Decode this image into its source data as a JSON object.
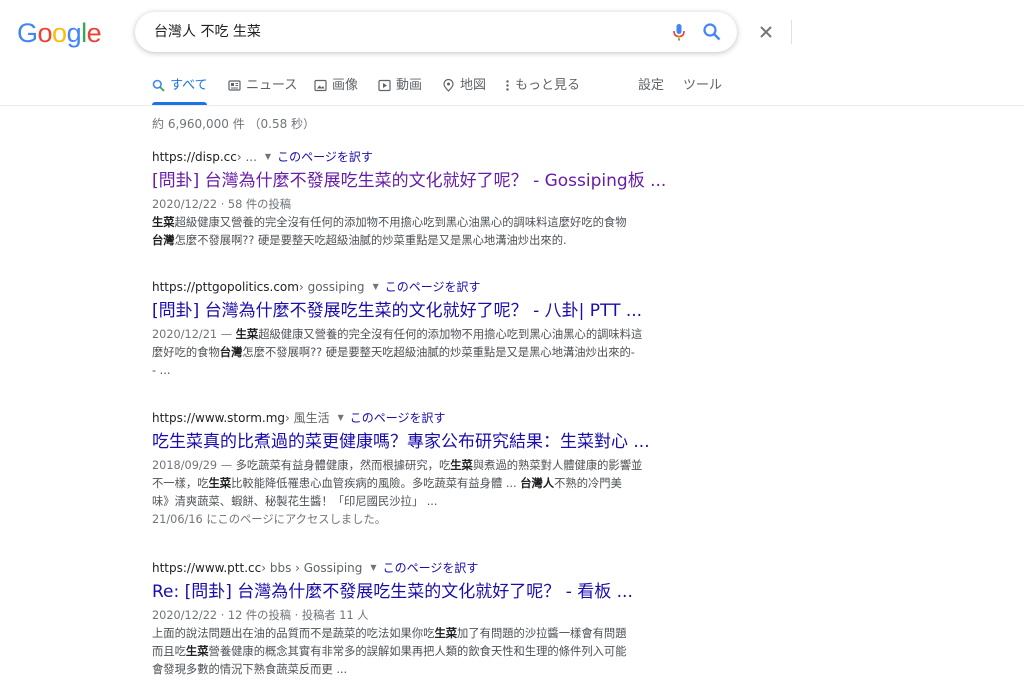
{
  "logo": {
    "letters": [
      "G",
      "o",
      "o",
      "g",
      "l",
      "e"
    ],
    "colors": [
      "#4285f4",
      "#ea4335",
      "#fbbc05",
      "#4285f4",
      "#34a853",
      "#ea4335"
    ]
  },
  "search": {
    "query": "台灣人 不吃 生菜"
  },
  "tabs": [
    {
      "label": "すべて",
      "icon": "search-icon"
    },
    {
      "label": "ニュース",
      "icon": "news-icon"
    },
    {
      "label": "画像",
      "icon": "image-icon"
    },
    {
      "label": "動画",
      "icon": "video-icon"
    },
    {
      "label": "地図",
      "icon": "map-pin-icon"
    },
    {
      "label": "もっと見る",
      "icon": "more-vert-icon"
    },
    {
      "label": "設定"
    },
    {
      "label": "ツール"
    }
  ],
  "stats": "約 6,960,000 件 （0.58 秒）",
  "results": [
    {
      "url": "https://disp.cc",
      "path": " › ...",
      "translate": "このページを訳す",
      "title": "[問卦] 台灣為什麼不發展吃生菜的文化就好了呢？ - Gossiping板 ...",
      "meta": "2020/12/22 · 58 件の投稿",
      "lines": [
        "<b>生菜</b>超級健康又營養的完全沒有任何的添加物不用擔心吃到黑心油黑心的調味料這麼好吃的食物",
        "<b>台灣</b>怎麼不發展啊?? 硬是要整天吃超級油膩的炒菜重點是又是黑心地溝油炒出來的."
      ]
    },
    {
      "url": "https://pttgopolitics.com",
      "path": " › gossiping",
      "translate": "このページを訳す",
      "title": "[問卦] 台灣為什麼不發展吃生菜的文化就好了呢？ - 八卦| PTT ...",
      "meta": "2020/12/21 — ",
      "lines": [
        "<b>生菜</b>超級健康又營養的完全沒有任何的添加物不用擔心吃到黑心油黑心的調味料這",
        "麼好吃的食物<b>台灣</b>怎麼不發展啊?? 硬是要整天吃超級油膩的炒菜重點是又是黑心地溝油炒出來的-",
        "- ..."
      ]
    },
    {
      "url": "https://www.storm.mg",
      "path": " › 風生活",
      "translate": "このページを訳す",
      "title": "吃生菜真的比煮過的菜更健康嗎？專家公布研究結果：生菜對心 ...",
      "meta": "2018/09/29 — ",
      "lines": [
        "多吃蔬菜有益身體健康，然而根據研究，吃<b>生菜</b>與煮過的熟菜對人體健康的影響並",
        "不一樣，吃<b>生菜</b>比較能降低罹患心血管疾病的風險。多吃蔬菜有益身體 ... <b>台灣人</b>不熟的冷門美",
        "味》清爽蔬菜、蝦餅、秘製花生醬！「印尼國民沙拉」 ...",
        "21/06/16 にこのページにアクセスしました。"
      ]
    },
    {
      "url": "https://www.ptt.cc",
      "path": " › bbs › Gossiping",
      "translate": "このページを訳す",
      "title": "Re: [問卦] 台灣為什麼不發展吃生菜的文化就好了呢？ - 看板 ...",
      "meta": "2020/12/22 · 12 件の投稿 · 投稿者 11 人",
      "lines": [
        "上面的說法問題出在油的品質而不是蔬菜的吃法如果你吃<b>生菜</b>加了有問題的沙拉醬一樣會有問題",
        "而且吃<b>生菜</b>營養健康的概念其實有非常多的誤解如果再把人類的飲食天性和生理的條件列入可能",
        "會發現多數的情況下熟食蔬菜反而更 ..."
      ]
    }
  ]
}
